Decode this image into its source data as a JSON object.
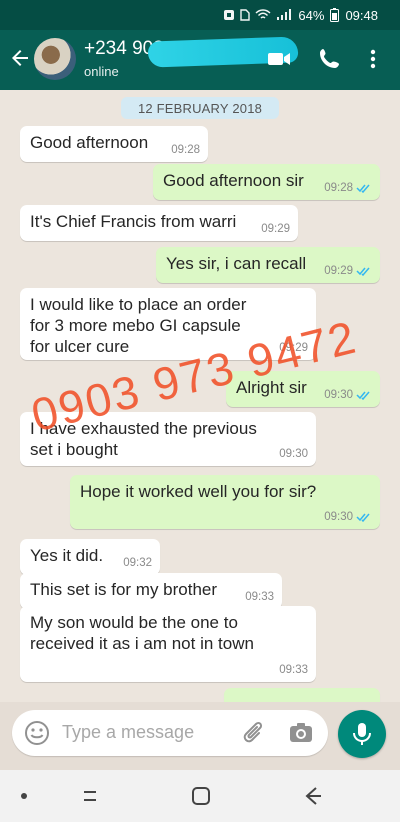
{
  "status_bar": {
    "battery": "64%",
    "time": "09:48",
    "indicators": [
      "notification-icon",
      "sim-icon",
      "wifi-icon",
      "signal-icon",
      "battery-icon"
    ]
  },
  "app_bar": {
    "contact_name": "+234 903",
    "status": "online",
    "icons": [
      "back-arrow-icon",
      "video-call-icon",
      "phone-icon",
      "more-icon"
    ],
    "color": "#075e54"
  },
  "chat": {
    "date_separator": "12 FEBRUARY 2018",
    "messages": [
      {
        "direction": "in",
        "text": "Good afternoon",
        "time": "09:28"
      },
      {
        "direction": "out",
        "text": "Good afternoon sir",
        "time": "09:28",
        "ticks": "read"
      },
      {
        "direction": "in",
        "text": "It's Chief Francis from warri",
        "time": "09:29"
      },
      {
        "direction": "out",
        "text": "Yes sir, i can recall",
        "time": "09:29",
        "ticks": "read"
      },
      {
        "direction": "in",
        "text": "I would like to place an order for 3 more mebo GI capsule for ulcer cure",
        "time": "09:29"
      },
      {
        "direction": "out",
        "text": "Alright sir",
        "time": "09:30",
        "ticks": "read"
      },
      {
        "direction": "in",
        "text": "I have exhausted the previous set i bought",
        "time": "09:30"
      },
      {
        "direction": "out",
        "text": "Hope it worked well you for sir?",
        "time": "09:30",
        "ticks": "read"
      },
      {
        "direction": "in",
        "text": "Yes it did.",
        "time": "09:32"
      },
      {
        "direction": "in",
        "text": "This set is for my brother",
        "time": "09:33"
      },
      {
        "direction": "in",
        "text": "My son would be the one to received it as i am not in town",
        "time": "09:33"
      }
    ],
    "watermark": "0903 973 9472"
  },
  "composer": {
    "placeholder": "Type a message",
    "icons": [
      "emoji-icon",
      "attach-icon",
      "camera-icon",
      "mic-icon"
    ],
    "accent": "#00897b"
  },
  "nav_bar": {
    "icons": [
      "dot-icon",
      "recent-apps-icon",
      "home-icon",
      "back-icon"
    ]
  }
}
